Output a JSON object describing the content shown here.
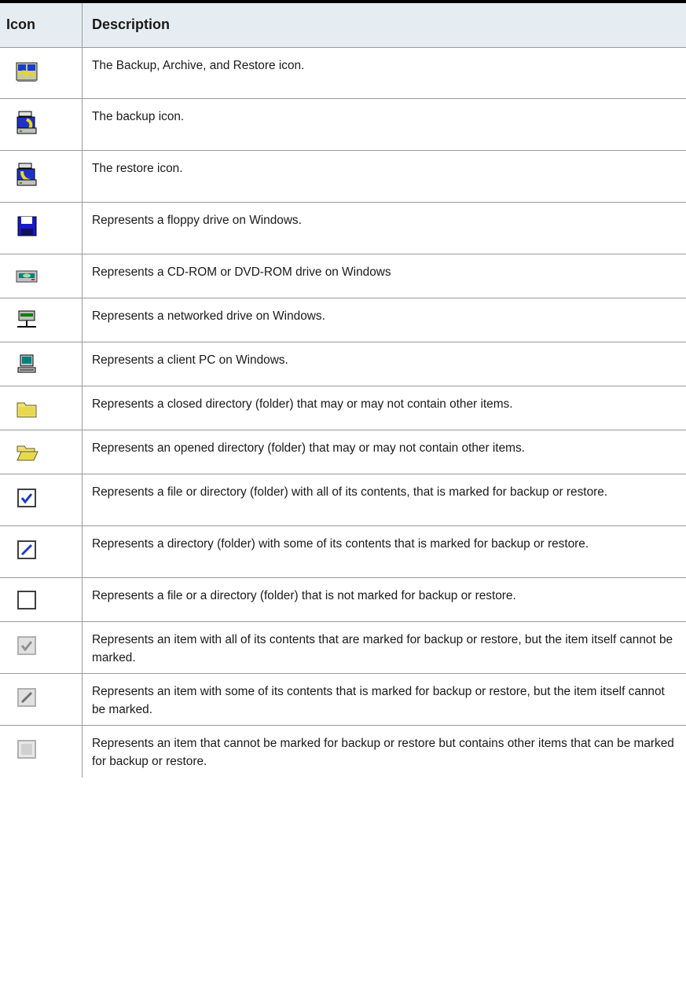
{
  "header": {
    "icon_col": "Icon",
    "desc_col": "Description"
  },
  "rows": [
    {
      "icon": "backup-archive-restore-icon",
      "desc": "The Backup, Archive, and Restore icon."
    },
    {
      "icon": "backup-icon",
      "desc": "The backup icon."
    },
    {
      "icon": "restore-icon",
      "desc": "The restore icon."
    },
    {
      "icon": "floppy-drive-icon",
      "desc": "Represents a floppy drive on Windows."
    },
    {
      "icon": "cdrom-drive-icon",
      "desc": "Represents a CD-ROM or DVD-ROM drive on Windows"
    },
    {
      "icon": "network-drive-icon",
      "desc": "Represents a networked drive on Windows."
    },
    {
      "icon": "client-pc-icon",
      "desc": "Represents a client PC on Windows."
    },
    {
      "icon": "closed-folder-icon",
      "desc": "Represents a closed directory (folder) that may or may not contain other items."
    },
    {
      "icon": "open-folder-icon",
      "desc": "Represents an opened directory (folder) that may or may not contain other items."
    },
    {
      "icon": "checkbox-checked-icon",
      "desc": "Represents a file or directory (folder) with all of its contents, that is marked for backup or restore."
    },
    {
      "icon": "checkbox-partial-icon",
      "desc": "Represents a directory (folder) with some of its contents that is marked for backup or restore."
    },
    {
      "icon": "checkbox-empty-icon",
      "desc": "Represents a file or a directory (folder) that is not marked for backup or restore."
    },
    {
      "icon": "checkbox-checked-disabled-icon",
      "desc": "Represents an item with all of its contents that are marked for backup or restore, but the item itself cannot be marked."
    },
    {
      "icon": "checkbox-partial-disabled-icon",
      "desc": "Represents an item with some of its contents that is marked for backup or restore, but the item itself cannot be marked."
    },
    {
      "icon": "checkbox-grayed-icon",
      "desc": "Represents an item that cannot be marked for backup or restore but contains other items that can be marked for backup or restore."
    }
  ]
}
